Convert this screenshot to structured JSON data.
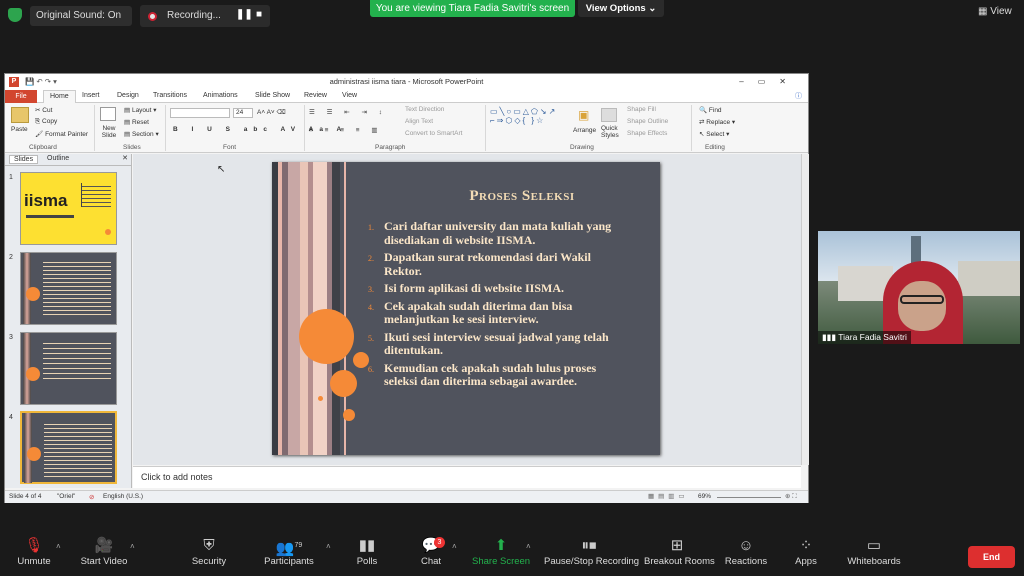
{
  "zoom_top": {
    "original_sound": "Original Sound: On",
    "recording": "Recording...",
    "viewing_banner": "You are viewing Tiara Fadia Savitri's screen",
    "view_options": "View Options",
    "view": "View"
  },
  "ppt": {
    "title": "administrasi iisma tiara - Microsoft PowerPoint",
    "tabs": [
      "File",
      "Home",
      "Insert",
      "Design",
      "Transitions",
      "Animations",
      "Slide Show",
      "Review",
      "View"
    ],
    "clipboard": {
      "paste": "Paste",
      "cut": "Cut",
      "copy": "Copy",
      "format_painter": "Format Painter",
      "label": "Clipboard"
    },
    "slides_grp": {
      "new_slide": "New Slide",
      "layout": "Layout",
      "reset": "Reset",
      "section": "Section",
      "label": "Slides"
    },
    "font": {
      "size": "24",
      "label": "Font"
    },
    "paragraph": {
      "text_direction": "Text Direction",
      "align_text": "Align Text",
      "convert": "Convert to SmartArt",
      "label": "Paragraph"
    },
    "drawing": {
      "arrange": "Arrange",
      "quick_styles": "Quick Styles",
      "shape_fill": "Shape Fill",
      "shape_outline": "Shape Outline",
      "shape_effects": "Shape Effects",
      "label": "Drawing"
    },
    "editing": {
      "find": "Find",
      "replace": "Replace",
      "select": "Select",
      "label": "Editing"
    },
    "panel_tabs": [
      "Slides",
      "Outline"
    ],
    "thumb1_brand": "iisma",
    "slide": {
      "title": "Proses Seleksi",
      "items": [
        {
          "n": "1.",
          "text": "Cari daftar university dan mata kuliah yang disediakan di website IISMA."
        },
        {
          "n": "2.",
          "text": "Dapatkan surat rekomendasi dari Wakil Rektor."
        },
        {
          "n": "3.",
          "text": "Isi form aplikasi di website IISMA."
        },
        {
          "n": "4.",
          "text": "Cek apakah sudah diterima dan bisa melanjutkan ke sesi interview."
        },
        {
          "n": "5.",
          "text": "Ikuti sesi interview sesuai jadwal yang telah ditentukan."
        },
        {
          "n": "6.",
          "text": "Kemudian cek apakah sudah lulus proses seleksi dan diterima sebagai awardee."
        }
      ]
    },
    "notes": "Click to add notes",
    "status": {
      "slide": "Slide 4 of 4",
      "theme": "\"Oriel\"",
      "lang": "English (U.S.)",
      "zoom": "69%"
    }
  },
  "video": {
    "name": "Tiara Fadia Savitri"
  },
  "bottom": {
    "unmute": "Unmute",
    "start_video": "Start Video",
    "security": "Security",
    "participants": "Participants",
    "participants_count": "79",
    "polls": "Polls",
    "chat": "Chat",
    "chat_badge": "3",
    "share": "Share Screen",
    "pause": "Pause/Stop Recording",
    "breakout": "Breakout Rooms",
    "reactions": "Reactions",
    "apps": "Apps",
    "whiteboards": "Whiteboards",
    "end": "End"
  },
  "colors": {
    "accent_orange": "#f58a37",
    "zoom_green": "#23b14d",
    "end_red": "#dd2f2f",
    "slide_bg": "#50535d",
    "ppt_file": "#d2462f"
  }
}
